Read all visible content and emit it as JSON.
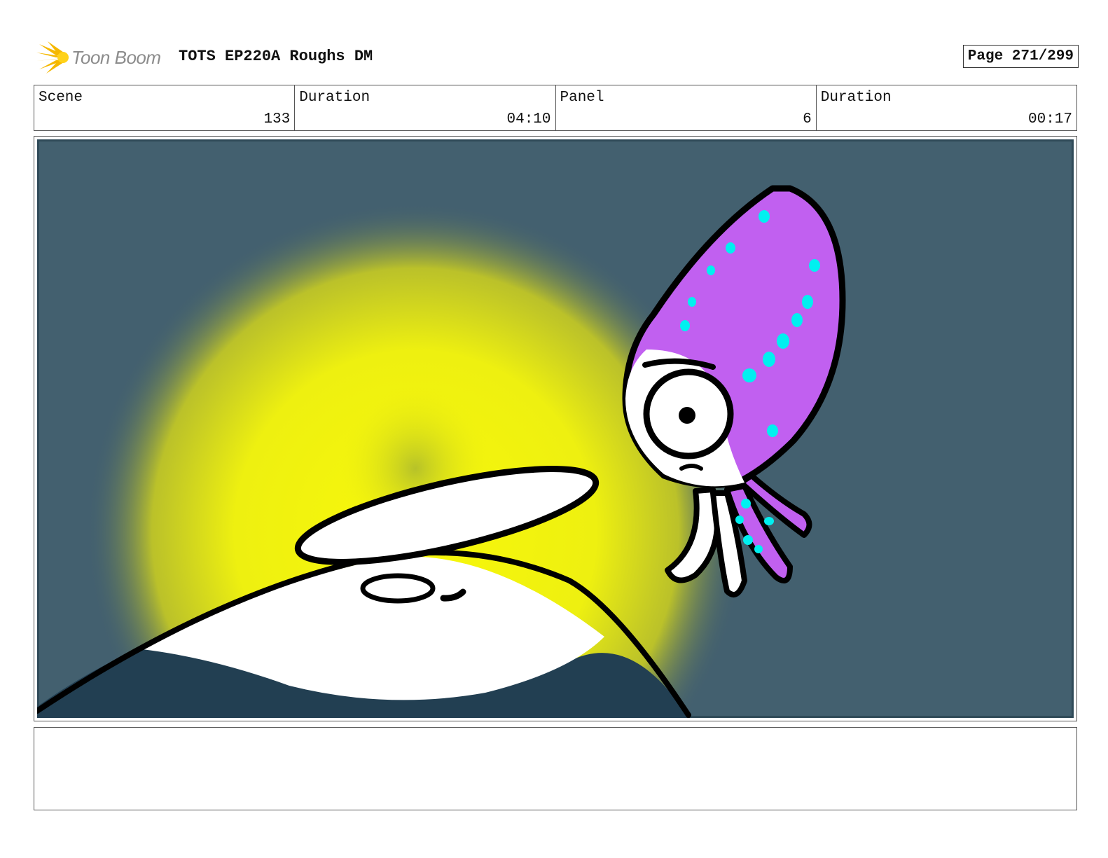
{
  "header": {
    "brand": "Toon Boom",
    "title": "TOTS EP220A Roughs DM",
    "page": "Page 271/299"
  },
  "info": [
    {
      "label": "Scene",
      "value": "133"
    },
    {
      "label": "Duration",
      "value": "04:10"
    },
    {
      "label": "Panel",
      "value": "6"
    },
    {
      "label": "Duration",
      "value": "00:17"
    }
  ],
  "colors": {
    "background": "#43606f",
    "glow": "#f4f60a",
    "squid_body": "#c160f0",
    "squid_spots": "#00f0f0",
    "dark_hill": "#223f52"
  },
  "notes": ""
}
